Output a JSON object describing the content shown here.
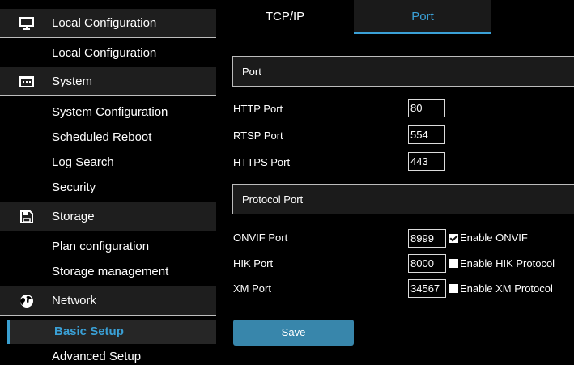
{
  "sidebar": {
    "groups": [
      {
        "label": "Local Configuration",
        "icon": "monitor-icon"
      },
      {
        "label": "System",
        "icon": "keyboard-icon"
      },
      {
        "label": "Storage",
        "icon": "floppy-disk-icon"
      },
      {
        "label": "Network",
        "icon": "globe-icon"
      }
    ],
    "local_items": [
      "Local Configuration"
    ],
    "system_items": [
      "System Configuration",
      "Scheduled Reboot",
      "Log Search",
      "Security"
    ],
    "storage_items": [
      "Plan configuration",
      "Storage management"
    ],
    "network_items": [
      "Basic Setup",
      "Advanced Setup"
    ],
    "active_item": "Basic Setup"
  },
  "tabs": [
    {
      "label": "TCP/IP",
      "active": false
    },
    {
      "label": "Port",
      "active": true
    }
  ],
  "port_section": {
    "title": "Port",
    "fields": [
      {
        "label": "HTTP Port",
        "value": "80"
      },
      {
        "label": "RTSP Port",
        "value": "554"
      },
      {
        "label": "HTTPS Port",
        "value": "443"
      }
    ]
  },
  "protocol_section": {
    "title": "Protocol Port",
    "fields": [
      {
        "label": "ONVIF Port",
        "value": "8999",
        "check_label": "Enable ONVIF",
        "checked": true
      },
      {
        "label": "HIK Port",
        "value": "8000",
        "check_label": "Enable HIK Protocol",
        "checked": false
      },
      {
        "label": "XM Port",
        "value": "34567",
        "check_label": "Enable XM Protocol",
        "checked": false
      }
    ]
  },
  "save_label": "Save",
  "colors": {
    "accent": "#3aa0d6",
    "button": "#3886ab",
    "group_bg": "#1e1e1e"
  }
}
